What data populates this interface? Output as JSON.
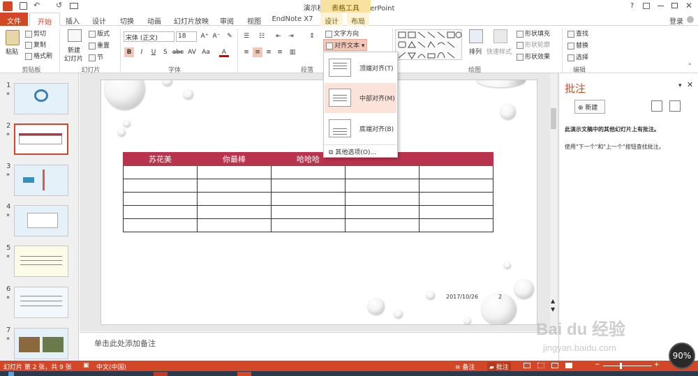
{
  "titlebar": {
    "title": "演示模板.pptx - PowerPoint",
    "context_tools": "表格工具",
    "help": "?",
    "login": "登录"
  },
  "tabs": [
    "文件",
    "开始",
    "插入",
    "设计",
    "切换",
    "动画",
    "幻灯片放映",
    "审阅",
    "视图",
    "EndNote X7",
    "设计",
    "布局"
  ],
  "ribbon": {
    "clipboard": {
      "paste": "粘贴",
      "cut": "剪切",
      "copy": "复制",
      "format_painter": "格式刷",
      "label": "剪贴板"
    },
    "slides": {
      "new_slide": "新建",
      "new_slide2": "幻灯片",
      "layout": "版式",
      "reset": "重置",
      "section": "节",
      "label": "幻灯片"
    },
    "font": {
      "name": "宋体 (正文)",
      "size": "18",
      "bold": "B",
      "italic": "I",
      "underline": "U",
      "strike": "S",
      "shadow": "abc",
      "spacing": "AV",
      "case": "Aa",
      "color": "A",
      "label": "字体"
    },
    "paragraph": {
      "text_direction": "文字方向",
      "align_text": "对齐文本",
      "label": "段落"
    },
    "drawing": {
      "arrange": "排列",
      "quick_styles": "快速样式",
      "shape_fill": "形状填充",
      "shape_outline": "形状轮廓",
      "shape_effects": "形状效果",
      "label": "绘图"
    },
    "editing": {
      "find": "查找",
      "replace": "替换",
      "select": "选择",
      "label": "编辑"
    }
  },
  "align_menu": {
    "items": [
      {
        "label": "顶端对齐(T)"
      },
      {
        "label": "中部对齐(M)"
      },
      {
        "label": "底端对齐(B)"
      }
    ],
    "more": "其他选项(O)..."
  },
  "thumbnails": [
    {
      "num": "1",
      "star": "*"
    },
    {
      "num": "2",
      "star": "*"
    },
    {
      "num": "3",
      "star": "*"
    },
    {
      "num": "4",
      "star": "*"
    },
    {
      "num": "5",
      "star": "*"
    },
    {
      "num": "6",
      "star": "*"
    },
    {
      "num": "7",
      "star": "*"
    }
  ],
  "slide": {
    "table_headers": [
      "苏花美",
      "你最棒",
      "哈哈哈",
      "",
      ""
    ],
    "date": "2017/10/26",
    "page": "2"
  },
  "notes_placeholder": "单击此处添加备注",
  "comments": {
    "title": "批注",
    "new_button": "新建",
    "msg1": "此演示文稿中的其他幻灯片上有批注。",
    "msg2": "使用\"下一个\"和\"上一个\"按钮查找批注。"
  },
  "status": {
    "slide_info": "幻灯片 第 2 张，共 9 张",
    "language": "中文(中国)",
    "notes": "备注",
    "comments": "批注",
    "zoom": "90%"
  },
  "watermark": {
    "brand": "Bai du 经验",
    "url": "jingyan.baidu.com"
  },
  "colors": {
    "accent": "#d24726",
    "table_header": "#b8344c",
    "context_tab": "#f7e2a0"
  }
}
